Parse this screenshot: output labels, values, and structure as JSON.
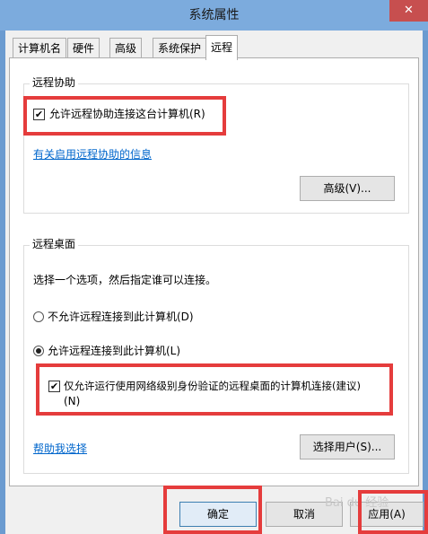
{
  "window": {
    "title": "系统属性",
    "close_glyph": "✕"
  },
  "tabs": [
    {
      "label": "计算机名"
    },
    {
      "label": "硬件"
    },
    {
      "label": "高级"
    },
    {
      "label": "系统保护"
    },
    {
      "label": "远程"
    }
  ],
  "remote_assistance": {
    "group_label": "远程协助",
    "allow_checkbox": {
      "label": "允许远程协助连接这台计算机(R)",
      "checked": true
    },
    "info_link": "有关启用远程协助的信息",
    "advanced_button": "高级(V)..."
  },
  "remote_desktop": {
    "group_label": "远程桌面",
    "instruction": "选择一个选项，然后指定谁可以连接。",
    "option_disallow": {
      "label": "不允许远程连接到此计算机(D)",
      "selected": false
    },
    "option_allow": {
      "label": "允许远程连接到此计算机(L)",
      "selected": true
    },
    "nla_checkbox": {
      "label_line1": "仅允许运行使用网络级别身份验证的远程桌面的计算机连接(建议)",
      "label_line2": "(N)",
      "checked": true
    },
    "help_link": "帮助我选择",
    "select_users_button": "选择用户(S)..."
  },
  "footer": {
    "ok": "确定",
    "cancel": "取消",
    "apply": "应用(A)"
  },
  "watermark": "Bai du 经验",
  "colors": {
    "highlight": "#e53c3c",
    "link": "#0066cc",
    "titlebar": "#7cabdd"
  }
}
